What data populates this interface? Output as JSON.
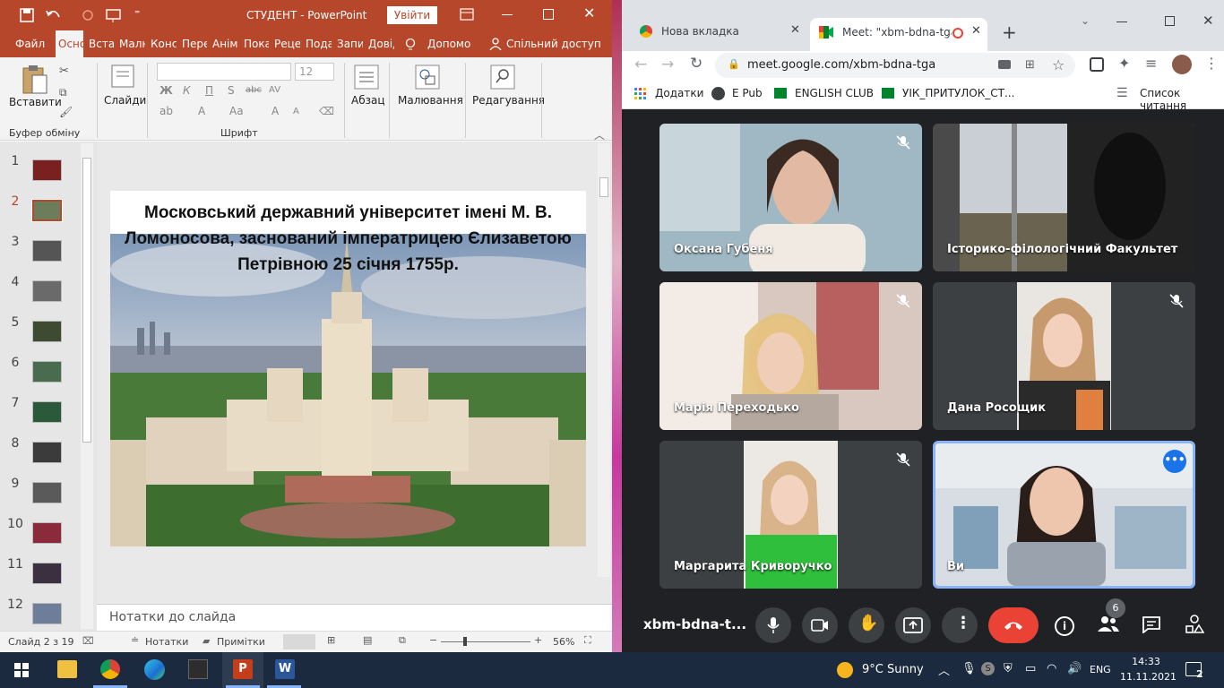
{
  "powerpoint": {
    "title": "СТУДЕНТ  -  PowerPoint",
    "signin_label": "Увійти",
    "tabs": [
      "Файл",
      "Осно",
      "Встав",
      "Малю",
      "Конс",
      "Пере",
      "Аніма",
      "Пока",
      "Реце",
      "Подан",
      "Запис",
      "Довід"
    ],
    "help_label": "Допомо",
    "share_label": "Спільний доступ",
    "ribbon": {
      "paste_label": "Вставити",
      "slides_label": "Слайди",
      "paragraph_label": "Абзац",
      "drawing_label": "Малювання",
      "editing_label": "Редагування",
      "font_size": "12",
      "group_clipboard": "Буфер обміну",
      "group_font": "Шрифт",
      "font_buttons": [
        "Ж",
        "К",
        "П",
        "S",
        "abc",
        "AV",
        "A",
        "Aa",
        "A",
        "A"
      ]
    },
    "thumbnails": [
      {
        "num": "1",
        "color": "#7a2020"
      },
      {
        "num": "2",
        "color": "#6b7d5a"
      },
      {
        "num": "3",
        "color": "#555555"
      },
      {
        "num": "4",
        "color": "#6a6a6a"
      },
      {
        "num": "5",
        "color": "#3e4a32"
      },
      {
        "num": "6",
        "color": "#4a6c4e"
      },
      {
        "num": "7",
        "color": "#2a5a3a"
      },
      {
        "num": "8",
        "color": "#3b3b3b"
      },
      {
        "num": "9",
        "color": "#5a5a5a"
      },
      {
        "num": "10",
        "color": "#8b2a3a"
      },
      {
        "num": "11",
        "color": "#3a3040"
      },
      {
        "num": "12",
        "color": "#6e7e9a"
      }
    ],
    "selected_slide": "2",
    "slide_title": "Московський державний університет імені М. В. Ломоносова, заснований імператрицею Єлизаветою Петрівною 25 січня 1755р.",
    "notes_placeholder": "Нотатки до слайда",
    "status": {
      "slide_of": "Слайд 2 з 19",
      "notes_label": "Нотатки",
      "comments_label": "Примітки",
      "zoom": "56%"
    }
  },
  "chrome": {
    "tabs": [
      {
        "title": "Нова вкладка",
        "icon": "chrome-icon"
      },
      {
        "title": "Meet: \"xbm-bdna-tga\"",
        "icon": "meet-icon"
      }
    ],
    "url": "meet.google.com/xbm-bdna-tga",
    "bookmarks": [
      "Додатки",
      "E Pub",
      "ENGLISH CLUB",
      "УІК_ПРИТУЛОК_СТ..."
    ],
    "reading_list": "Список читання"
  },
  "meet": {
    "participants": [
      {
        "name": "Оксана Губеня",
        "muted": true
      },
      {
        "name": "Історико-філологічний Факультет",
        "muted": false
      },
      {
        "name": "Марія Переходько",
        "muted": true
      },
      {
        "name": "Дана Росощик",
        "muted": true
      },
      {
        "name": "Маргарита Криворучко",
        "muted": true
      },
      {
        "name": "Ви",
        "muted": false
      }
    ],
    "meeting_code": "xbm-bdna-t...",
    "people_count": "6",
    "end_call_color": "#ea4335"
  },
  "taskbar": {
    "weather": "9°C  Sunny",
    "language": "ENG",
    "time": "14:33",
    "date": "11.11.2021",
    "notifications": "2"
  }
}
